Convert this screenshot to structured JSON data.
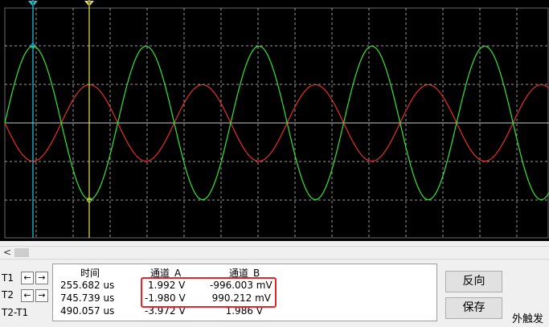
{
  "scope": {
    "background": "#000000",
    "grid_color": "#9a9a9a",
    "channel_a_color": "#33e633",
    "channel_b_color": "#e62e2e",
    "cursor_t1_color": "#19d4e6",
    "cursor_t2_color": "#e6e64d",
    "channel_a_amplitude_v": 1.99,
    "channel_b_amplitude_v": 0.99,
    "cycles_visible": 4.7,
    "cursor_t1_label": "T",
    "cursor_t2_label": "T"
  },
  "scrollbar": {
    "left_arrow": "<"
  },
  "cursors": {
    "t1_label": "T1",
    "t2_label": "T2",
    "diff_label": "T2-T1",
    "left_icon": "←",
    "right_icon": "→"
  },
  "table": {
    "headers": {
      "time": "时间",
      "channel_a": "通道_A",
      "channel_b": "通道_B"
    },
    "rows": [
      {
        "time": "255.682 us",
        "a": "1.992 V",
        "b": "-996.003 mV"
      },
      {
        "time": "745.739 us",
        "a": "-1.980 V",
        "b": "990.212 mV"
      },
      {
        "time": "490.057 us",
        "a": "-3.972 V",
        "b": "1.986 V"
      }
    ]
  },
  "buttons": {
    "invert": "反向",
    "save": "保存"
  },
  "external_trigger": "外触发",
  "highlight_color": "#e8242a"
}
